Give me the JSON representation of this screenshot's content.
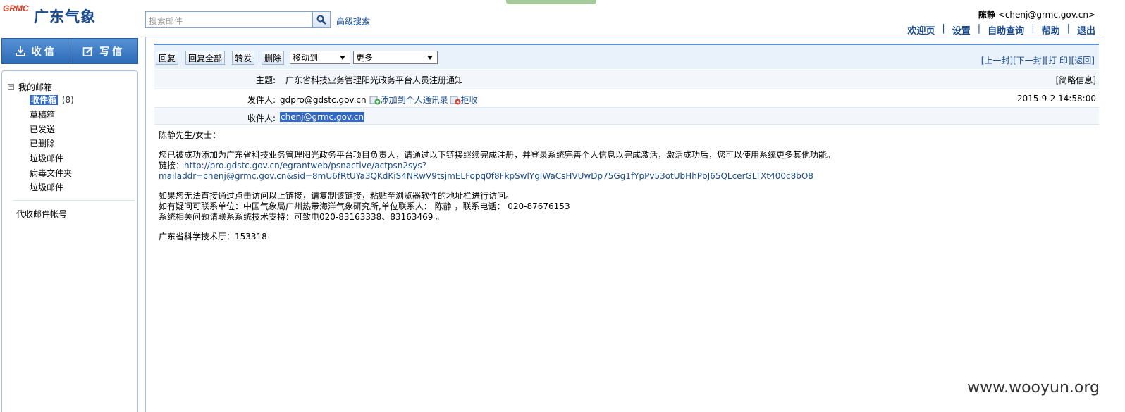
{
  "logo": {
    "en": "GRMC",
    "cn": "广东气象"
  },
  "search": {
    "placeholder": "搜索邮件",
    "advanced": "高级搜索"
  },
  "user": {
    "name": "陈静",
    "email": "<chenj@grmc.gov.cn>"
  },
  "top_links": [
    "欢迎页",
    "设置",
    "自助查询",
    "帮助",
    "退出"
  ],
  "left": {
    "receive_label": "收信",
    "compose_label": "写信",
    "root_label": "我的邮箱",
    "folders": [
      {
        "label": "收件箱",
        "count": "(8)"
      },
      {
        "label": "草稿箱"
      },
      {
        "label": "已发送"
      },
      {
        "label": "已删除"
      },
      {
        "label": "垃圾邮件"
      },
      {
        "label": "病毒文件夹"
      },
      {
        "label": "垃圾邮件"
      }
    ],
    "collect_label": "代收邮件帐号"
  },
  "toolbar": {
    "reply": "回复",
    "reply_all": "回复全部",
    "forward": "转发",
    "delete": "删除",
    "move_to": "移动到",
    "more": "更多",
    "prev": "[上一封]",
    "next": "[下一封]",
    "print": "[打 印]",
    "back": "[返回]"
  },
  "message": {
    "subject_key": "主题:",
    "subject": "广东省科技业务管理阳光政务平台人员注册通知",
    "brief": "[简略信息]",
    "from_key": "发件人:",
    "from": "gdpro@gdstc.gov.cn",
    "add_contact": "添加到个人通讯录",
    "reject": "拒收",
    "date": "2015-9-2 14:58:00",
    "to_key": "收件人:",
    "to": "chenj@grmc.gov.cn",
    "greeting": "陈静先生/女士：",
    "para1": "您已被成功添加为广东省科技业务管理阳光政务平台项目负责人，请通过以下链接继续完成注册，并登录系统完善个人信息以完成激活，激活成功后，您可以使用系统更多其他功能。",
    "link_label": "链接：",
    "link_url": "http://pro.gdstc.gov.cn/egrantweb/psnactive/actpsn2sys?mailaddr=chenj@grmc.gov.cn&sid=8mU6fRtUYa3QKdKiS4NRwV9tsjmELFopq0f8FkpSwlYgIWaCsHVUwDp75Gg1fYpPv53otUbHhPbJ65QLcerGLTXt400c8bO8",
    "para2_line1": "如果您无法直接通过点击访问以上链接，请复制该链接，粘贴至浏览器软件的地址栏进行访问。",
    "para2_line2": "如有疑问可联系单位：中国气象局广州热带海洋气象研究所,单位联系人： 陈静 ，联系电话： 020-87676153",
    "para2_line3": "系统相关问题请联系系统技术支持：可致电020-83163338、83163469 。",
    "signature": "广东省科学技术厅：153318"
  },
  "watermark": "www.wooyun.org"
}
